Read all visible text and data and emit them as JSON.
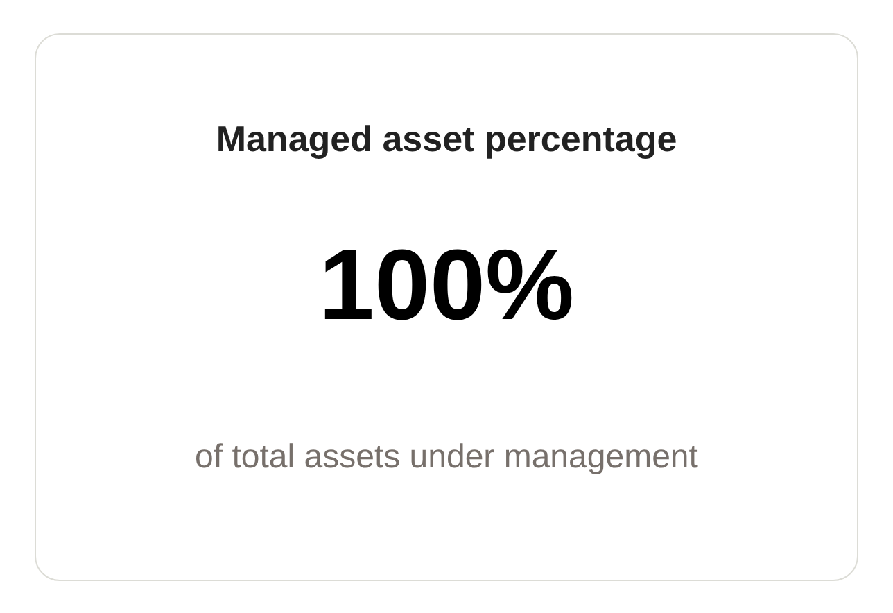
{
  "card": {
    "title": "Managed asset percentage",
    "value": "100%",
    "caption": "of total assets under management"
  }
}
